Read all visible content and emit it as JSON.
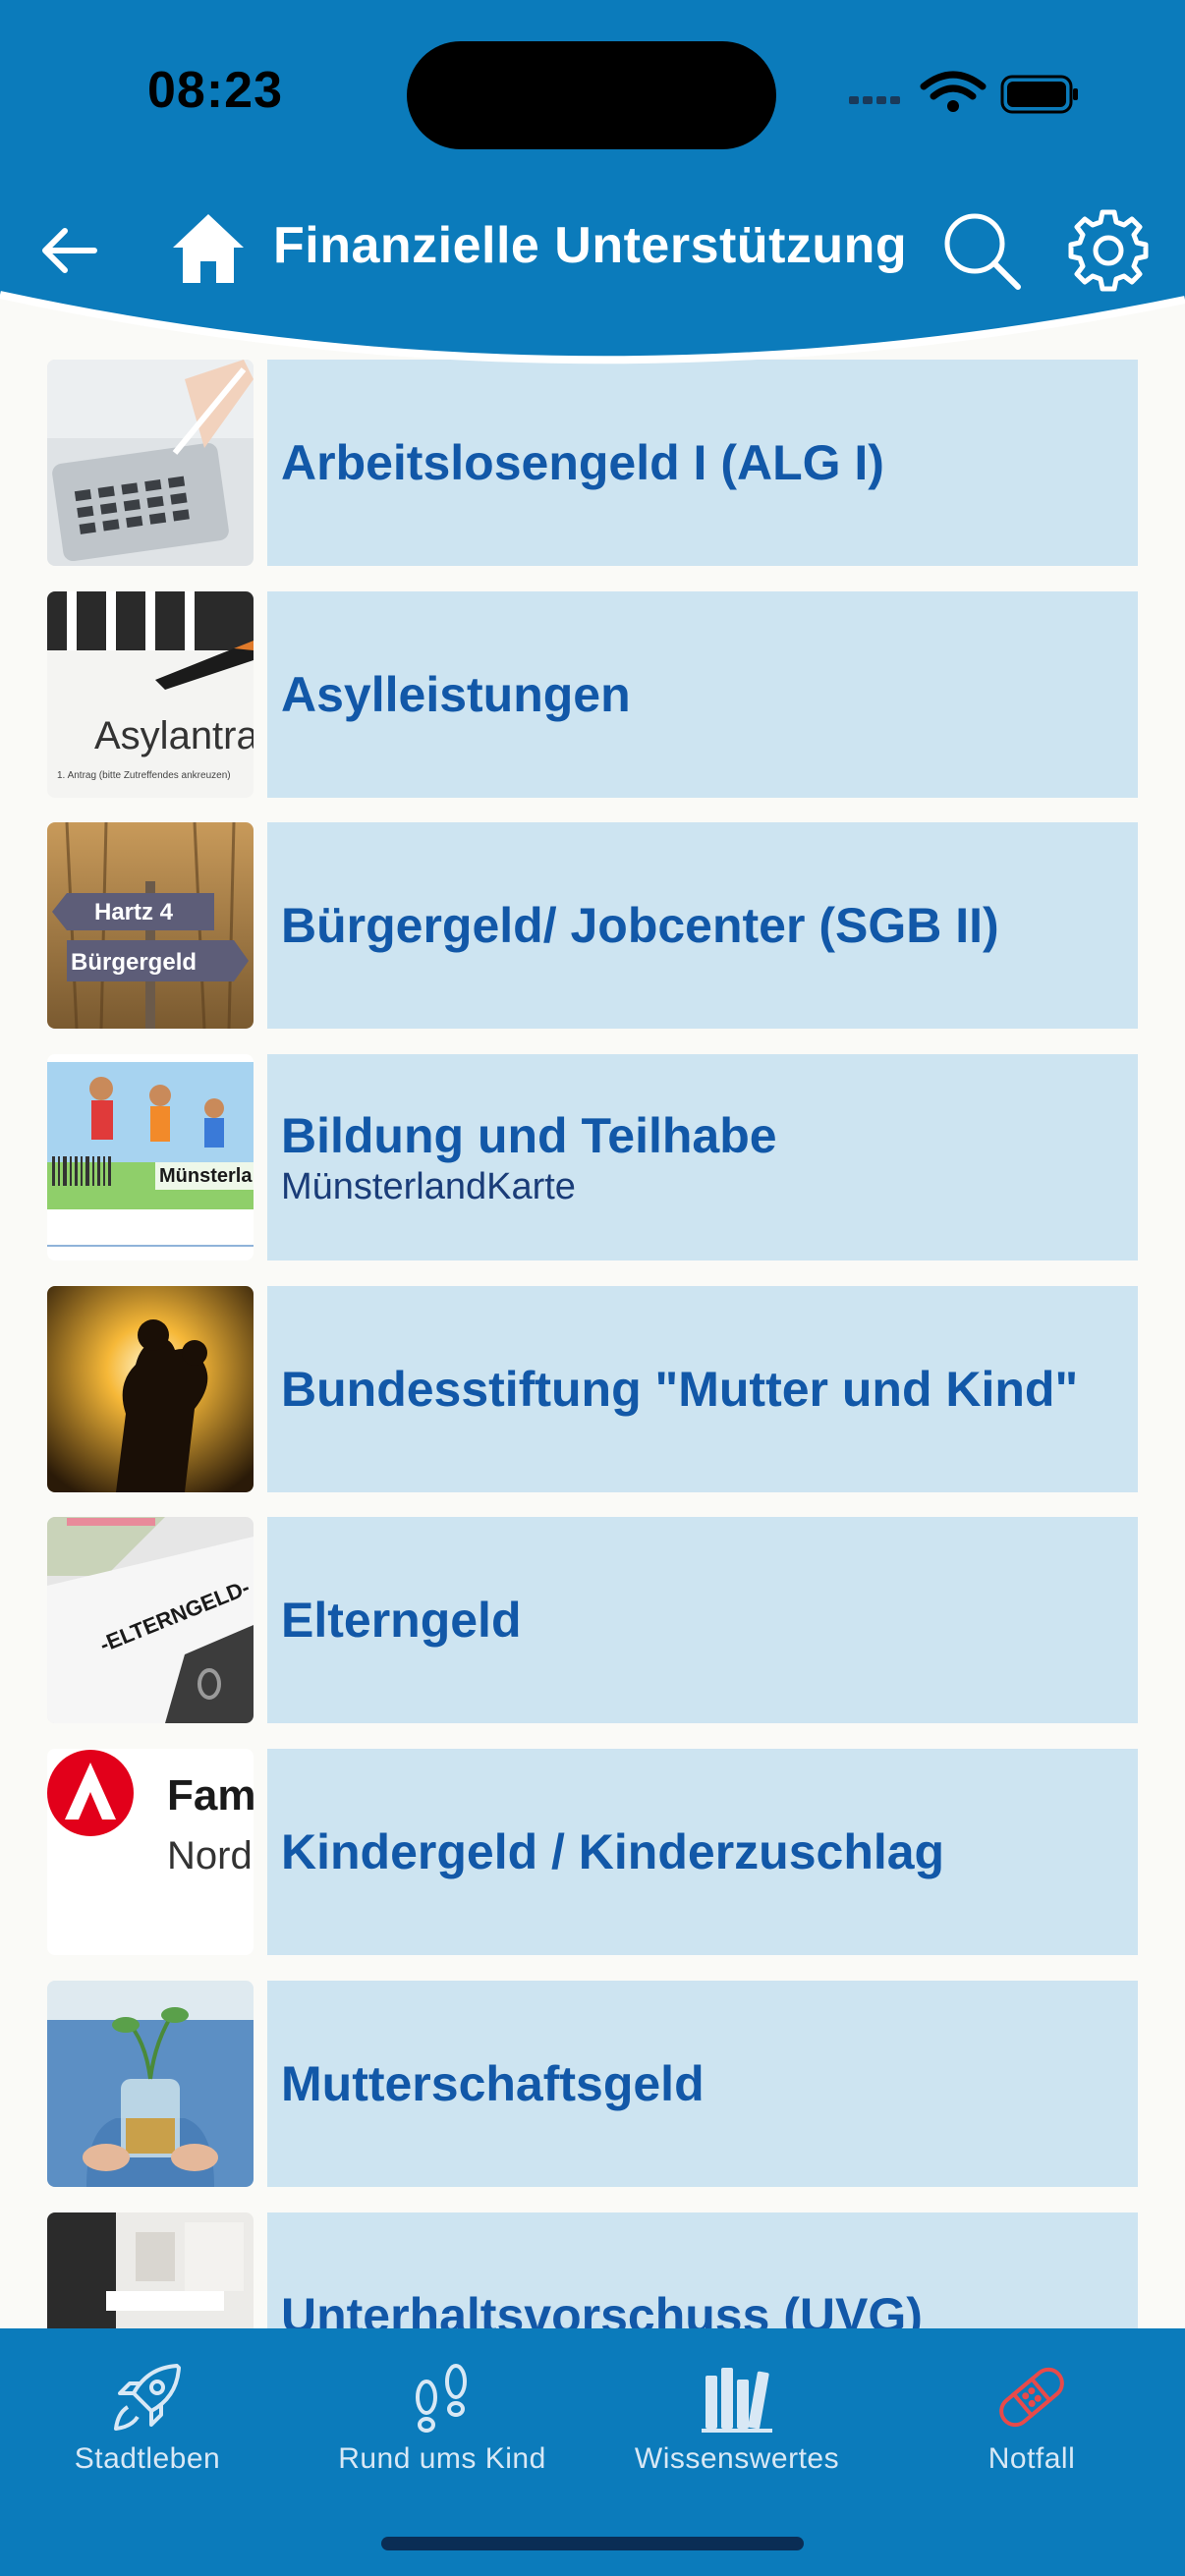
{
  "status_bar": {
    "time": "08:23"
  },
  "header": {
    "title": "Finanzielle Unterstützung",
    "back_icon": "arrow-left-icon",
    "home_icon": "home-icon",
    "search_icon": "search-icon",
    "settings_icon": "gear-icon",
    "color": "#0b7bbb"
  },
  "list": {
    "items": [
      {
        "title": "Arbeitslosengeld I (ALG I)",
        "subtitle": "",
        "thumb": "calculator-photo"
      },
      {
        "title": "Asylleistungen",
        "subtitle": "",
        "thumb": "asylum-application-photo",
        "thumb_text": "Asylantra",
        "thumb_small": "1. Antrag (bitte Zutreffendes ankreuzen)"
      },
      {
        "title": "Bürgergeld/ Jobcenter (SGB II)",
        "subtitle": "",
        "thumb": "signpost-photo",
        "thumb_text_1": "Hartz 4",
        "thumb_text_2": "Bürgergeld"
      },
      {
        "title": "Bildung und Teilhabe",
        "subtitle": "MünsterlandKarte",
        "thumb": "children-running-card",
        "thumb_text": "Münsterla"
      },
      {
        "title": "Bundesstiftung \"Mutter und Kind\"",
        "subtitle": "",
        "thumb": "mother-child-sunset-photo"
      },
      {
        "title": "Elterngeld",
        "subtitle": "",
        "thumb": "elterngeld-document-photo",
        "thumb_text": "-ELTERNGELD-"
      },
      {
        "title": "Kindergeld / Kinderzuschlag",
        "subtitle": "",
        "thumb": "agency-logo",
        "thumb_text_1": "Fam",
        "thumb_text_2": "Nord"
      },
      {
        "title": "Mutterschaftsgeld",
        "subtitle": "",
        "thumb": "coin-jar-photo"
      },
      {
        "title": "Unterhaltsvorschuss (UVG)",
        "subtitle": "",
        "thumb": "office-photo"
      }
    ]
  },
  "tabbar": {
    "tabs": [
      {
        "label": "Stadtleben",
        "icon": "rocket-icon"
      },
      {
        "label": "Rund ums Kind",
        "icon": "footprints-icon"
      },
      {
        "label": "Wissenswertes",
        "icon": "books-icon"
      },
      {
        "label": "Notfall",
        "icon": "bandage-icon",
        "color": "#e84a4a"
      }
    ]
  }
}
